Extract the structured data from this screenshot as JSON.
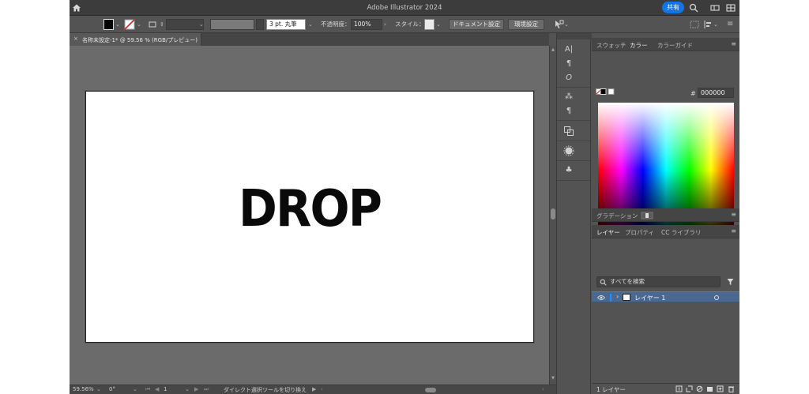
{
  "app": {
    "title": "Adobe Illustrator 2024",
    "share_label": "共有"
  },
  "control_bar": {
    "stroke_weight": "3 pt. 丸筆",
    "opacity_label": "不透明度：",
    "opacity_value": "100%",
    "style_label": "スタイル：",
    "document_setup_label": "ドキュメント設定",
    "preferences_label": "環境設定"
  },
  "document": {
    "tab_title": "名称未設定-1* @ 59.56 % (RGB/プレビュー)",
    "artwork_text": "DROP",
    "zoom": "59.56%",
    "rotation": "0°",
    "artboard_number": "1",
    "status_text": "ダイレクト選択ツールを切り換え"
  },
  "panels": {
    "color_tabs": [
      "スウォッチ",
      "カラー",
      "カラーガイド"
    ],
    "active_color_tab": "カラー",
    "hex_label": "#",
    "hex_value": "000000",
    "gradient_tab": "グラデーション",
    "layer_tabs": [
      "レイヤー",
      "プロパティ",
      "CC ライブラリ"
    ],
    "active_layer_tab": "レイヤー",
    "layer_search_placeholder": "すべてを検索",
    "layers": [
      {
        "name": "レイヤー 1"
      }
    ],
    "layer_count": "1 レイヤー"
  },
  "colors": {
    "accent": "#1473e6",
    "layer_selection": "#4b6990",
    "ui_background": "#535353",
    "pasteboard": "#6b6b6b"
  }
}
